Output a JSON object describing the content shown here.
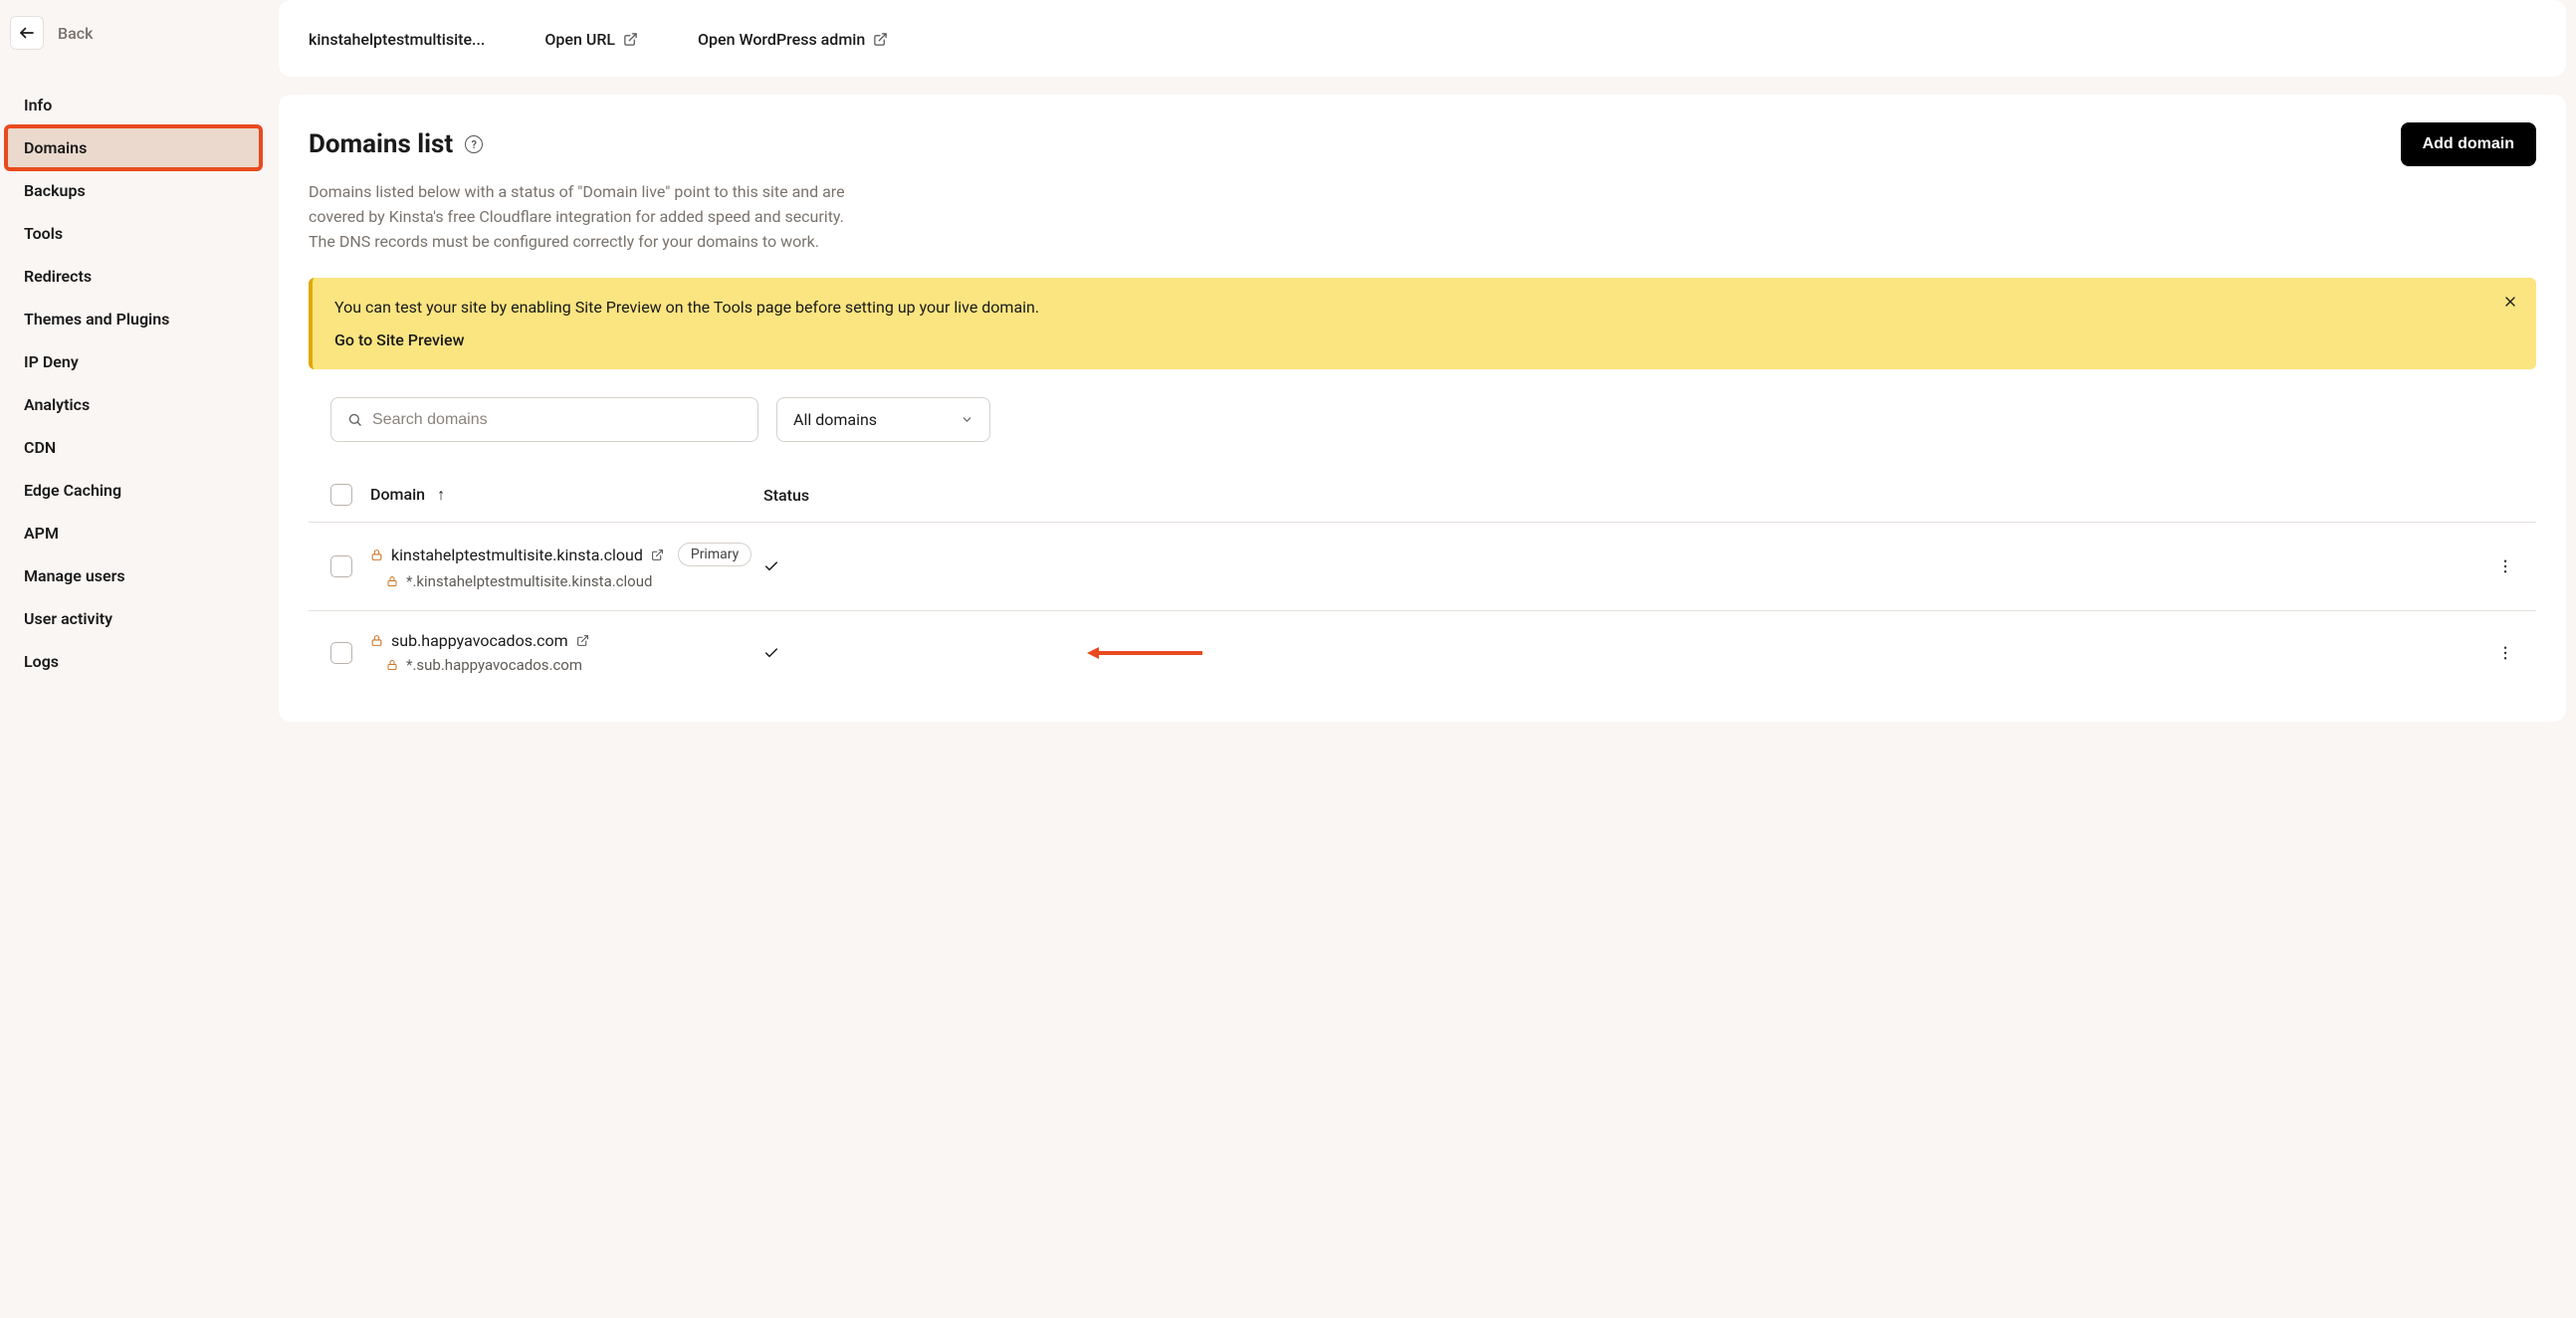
{
  "back": {
    "label": "Back"
  },
  "sidebar": {
    "items": [
      {
        "label": "Info"
      },
      {
        "label": "Domains",
        "active": true
      },
      {
        "label": "Backups"
      },
      {
        "label": "Tools"
      },
      {
        "label": "Redirects"
      },
      {
        "label": "Themes and Plugins"
      },
      {
        "label": "IP Deny"
      },
      {
        "label": "Analytics"
      },
      {
        "label": "CDN"
      },
      {
        "label": "Edge Caching"
      },
      {
        "label": "APM"
      },
      {
        "label": "Manage users"
      },
      {
        "label": "User activity"
      },
      {
        "label": "Logs"
      }
    ]
  },
  "header": {
    "site_name": "kinstahelptestmultisite...",
    "open_url": "Open URL",
    "open_wp": "Open WordPress admin"
  },
  "domains": {
    "title": "Domains list",
    "help_glyph": "?",
    "add_button": "Add domain",
    "description": "Domains listed below with a status of \"Domain live\" point to this site and are covered by Kinsta's free Cloudflare integration for added speed and security. The DNS records must be configured correctly for your domains to work.",
    "banner": {
      "text": "You can test your site by enabling Site Preview on the Tools page before setting up your live domain.",
      "link": "Go to Site Preview"
    },
    "search_placeholder": "Search domains",
    "filter_selected": "All domains",
    "columns": {
      "domain": "Domain",
      "status": "Status"
    },
    "primary_badge": "Primary",
    "rows": [
      {
        "domain": "kinstahelptestmultisite.kinsta.cloud",
        "wildcard": "*.kinstahelptestmultisite.kinsta.cloud",
        "primary": true
      },
      {
        "domain": "sub.happyavocados.com",
        "wildcard": "*.sub.happyavocados.com",
        "primary": false
      }
    ]
  }
}
